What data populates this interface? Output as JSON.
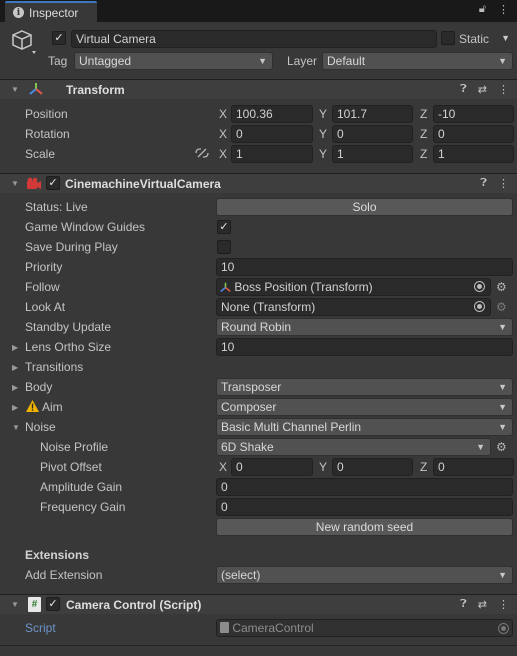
{
  "window": {
    "tab_label": "Inspector",
    "tab_icon": "info-icon",
    "lock_icon": "lock-icon",
    "menu_icon": "kebab-icon"
  },
  "gameobject": {
    "active": true,
    "name": "Virtual Camera",
    "static_label": "Static",
    "static_checked": false,
    "tag_label": "Tag",
    "tag_value": "Untagged",
    "layer_label": "Layer",
    "layer_value": "Default"
  },
  "transform": {
    "title": "Transform",
    "rows": [
      {
        "label": "Position",
        "x": "100.36",
        "y": "101.7",
        "z": "-10"
      },
      {
        "label": "Rotation",
        "x": "0",
        "y": "0",
        "z": "0"
      },
      {
        "label": "Scale",
        "x": "1",
        "y": "1",
        "z": "1"
      }
    ],
    "axis_x": "X",
    "axis_y": "Y",
    "axis_z": "Z"
  },
  "vcam": {
    "title": "CinemachineVirtualCamera",
    "enabled": true,
    "status_label": "Status: Live",
    "solo_label": "Solo",
    "game_window_guides_label": "Game Window Guides",
    "game_window_guides": true,
    "save_during_play_label": "Save During Play",
    "save_during_play": false,
    "priority_label": "Priority",
    "priority": "10",
    "follow_label": "Follow",
    "follow_value": "Boss Position (Transform)",
    "look_at_label": "Look At",
    "look_at_value": "None (Transform)",
    "standby_label": "Standby Update",
    "standby_value": "Round Robin",
    "lens_label": "Lens Ortho Size",
    "lens_value": "10",
    "transitions_label": "Transitions",
    "body_label": "Body",
    "body_value": "Transposer",
    "aim_label": "Aim",
    "aim_value": "Composer",
    "noise_label": "Noise",
    "noise_value": "Basic Multi Channel Perlin",
    "noise_profile_label": "Noise Profile",
    "noise_profile_value": "6D Shake",
    "pivot_label": "Pivot Offset",
    "pivot_x": "0",
    "pivot_y": "0",
    "pivot_z": "0",
    "amplitude_label": "Amplitude Gain",
    "amplitude_value": "0",
    "frequency_label": "Frequency Gain",
    "frequency_value": "0",
    "random_seed_label": "New random seed",
    "extensions_heading": "Extensions",
    "add_extension_label": "Add Extension",
    "add_extension_value": "(select)"
  },
  "script_component": {
    "title": "Camera Control (Script)",
    "enabled": true,
    "script_label": "Script",
    "script_value": "CameraControl"
  },
  "colors": {
    "accent": "#3a79bb",
    "panel": "#383838",
    "header": "#3e3e3e",
    "warning": "#f0b400"
  }
}
